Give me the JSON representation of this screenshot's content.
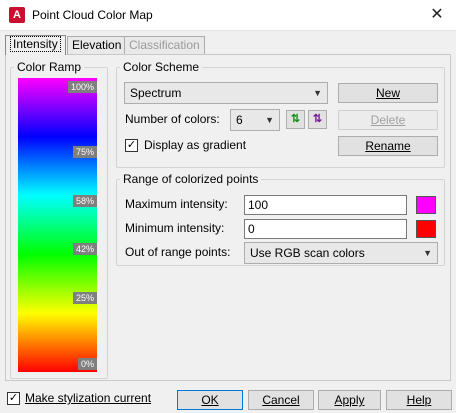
{
  "window": {
    "title": "Point Cloud Color Map",
    "app_icon_letter": "A",
    "close_glyph": "✕"
  },
  "tabs": [
    {
      "label": "Intensity",
      "active": true,
      "enabled": true
    },
    {
      "label": "Elevation",
      "active": false,
      "enabled": true
    },
    {
      "label": "Classification",
      "active": false,
      "enabled": false
    }
  ],
  "color_ramp": {
    "title": "Color Ramp",
    "ticks": [
      "100%",
      "75%",
      "58%",
      "42%",
      "25%",
      "0%"
    ],
    "colors": [
      "#ff00ff",
      "#0000ff",
      "#00ffff",
      "#00ff00",
      "#ffff00",
      "#ff0000"
    ]
  },
  "color_scheme": {
    "title": "Color Scheme",
    "scheme_value": "Spectrum",
    "num_colors_label": "Number of colors:",
    "num_colors_value": "6",
    "display_gradient_label": "Display as gradient",
    "display_gradient_checked": true,
    "new_label": "New",
    "delete_label": "Delete",
    "rename_label": "Rename"
  },
  "range": {
    "title": "Range of colorized points",
    "max_label": "Maximum intensity:",
    "max_value": "100",
    "max_color": "#ff00ff",
    "min_label": "Minimum intensity:",
    "min_value": "0",
    "min_color": "#ff0000",
    "out_of_range_label": "Out of range points:",
    "out_of_range_value": "Use RGB scan colors"
  },
  "footer": {
    "make_current_label": "Make stylization current",
    "make_current_checked": true,
    "ok_label": "OK",
    "cancel_label": "Cancel",
    "apply_label": "Apply",
    "help_label": "Help"
  },
  "check_glyph": "✓"
}
